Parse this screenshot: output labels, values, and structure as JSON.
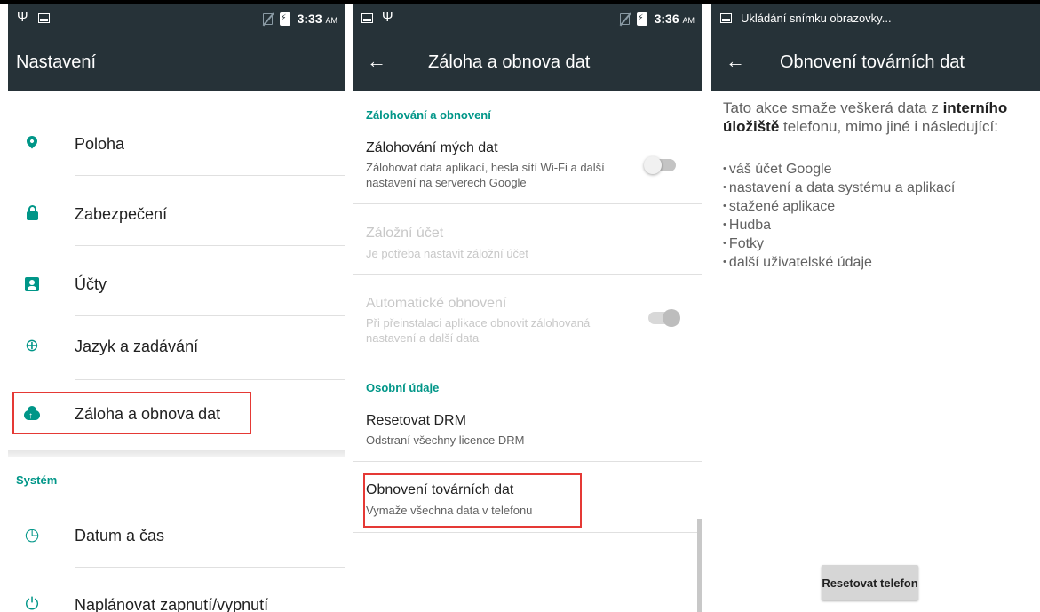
{
  "screen1": {
    "status": {
      "time": "3:33",
      "ampm": "AM",
      "icons": [
        "usb-icon",
        "screenshot-icon",
        "no-sim-icon",
        "battery-charging-icon"
      ]
    },
    "toolbar": {
      "title": "Nastavení"
    },
    "items": [
      {
        "label": "Poloha",
        "icon": "location-pin-icon"
      },
      {
        "label": "Zabezpečení",
        "icon": "lock-icon"
      },
      {
        "label": "Účty",
        "icon": "account-box-icon"
      },
      {
        "label": "Jazyk a zadávání",
        "icon": "globe-icon"
      },
      {
        "label": "Záloha a obnova dat",
        "icon": "cloud-upload-icon"
      }
    ],
    "section_system": "Systém",
    "system_items": [
      {
        "label": "Datum a čas",
        "icon": "clock-icon"
      },
      {
        "label": "Naplánovat zapnutí/vypnutí",
        "icon": "power-schedule-icon"
      }
    ]
  },
  "screen2": {
    "status": {
      "time": "3:36",
      "ampm": "AM"
    },
    "toolbar": {
      "title": "Záloha a obnova dat"
    },
    "section_backup": "Zálohování a obnovení",
    "backup_my_data": {
      "title": "Zálohování mých dat",
      "summary": "Zálohovat data aplikací, hesla sítí Wi-Fi a další nastavení na serverech Google"
    },
    "backup_account": {
      "title": "Záložní účet",
      "summary": "Je potřeba nastavit záložní účet"
    },
    "auto_restore": {
      "title": "Automatické obnovení",
      "summary": "Při přeinstalaci aplikace obnovit zálohovaná nastavení a další data"
    },
    "section_personal": "Osobní údaje",
    "reset_drm": {
      "title": "Resetovat DRM",
      "summary": "Odstraní všechny licence DRM"
    },
    "factory_reset": {
      "title": "Obnovení továrních dat",
      "summary": "Vymaže všechna data v telefonu"
    }
  },
  "screen3": {
    "status": {
      "notification": "Ukládání snímku obrazovky..."
    },
    "toolbar": {
      "title": "Obnovení továrních dat"
    },
    "intro_before": "Tato akce smaže veškerá data z ",
    "intro_bold": "interního úložiště",
    "intro_after": " telefonu, mimo jiné i následující:",
    "list": [
      "váš účet Google",
      "nastavení a data systému a aplikací",
      "stažené aplikace",
      "Hudba",
      "Fotky",
      "další uživatelské údaje"
    ],
    "reset_button": "Resetovat telefon"
  }
}
